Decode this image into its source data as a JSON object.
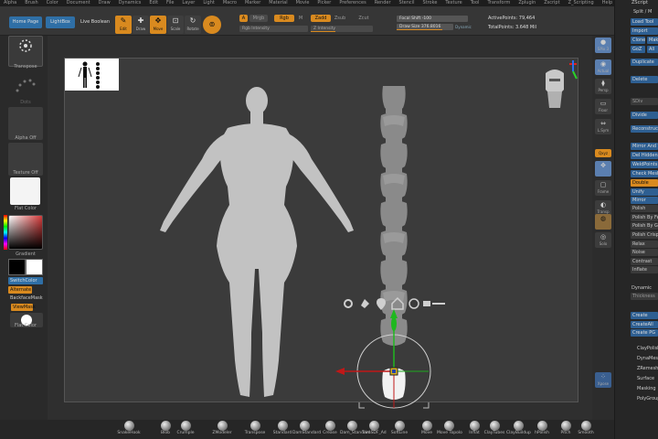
{
  "menu": [
    "Alpha",
    "Brush",
    "Color",
    "Document",
    "Draw",
    "Dynamics",
    "Edit",
    "File",
    "Layer",
    "Light",
    "Macro",
    "Marker",
    "Material",
    "Movie",
    "Picker",
    "Preferences",
    "Render",
    "Stencil",
    "Stroke",
    "Texture",
    "Tool",
    "Transform",
    "Zplugin",
    "Zscript",
    "Z_Scripting",
    "Help"
  ],
  "toolbar": {
    "home_page": "Home Page",
    "lightbox": "LightBox",
    "live_boolean": "Live Boolean",
    "edit": "Edit",
    "draw": "Draw",
    "move": "Move",
    "scale": "Scale",
    "rotate": "Rotate",
    "a_label": "A",
    "mrgb": "Mrgb",
    "rgb": "Rgb",
    "m": "M",
    "zadd": "Zadd",
    "zsub": "Zsub",
    "zcut": "Zcut",
    "rgb_intensity": "Rgb Intensity",
    "z_intensity": "Z Intensity",
    "focal_shift": "Focal Shift -100",
    "draw_size": "Draw Size 376.8016",
    "dynamic": "Dynamic",
    "active_points": "ActivePoints: 79,464",
    "total_points": "TotalPoints: 3.648 Mil"
  },
  "left": {
    "transpose": "Transpose",
    "dots": "Dots",
    "alpha_off": "Alpha Off",
    "texture_off": "Texture Off",
    "flat_color_material": "Flat Color",
    "gradient": "Gradient",
    "switch_color": "SwitchColor",
    "alternate": "Alternate",
    "backface_mask": "BackfaceMask",
    "view_mask": "ViewMask",
    "flat_color": "Flat Color"
  },
  "right": {
    "spix": "SPix 3",
    "actual": "Actual",
    "persp": "Persp",
    "floor": "Floor",
    "lsym": "L.Sym",
    "qxyz": "Qxyz",
    "transp": "Transp",
    "frame": "Frame",
    "solo": "Solo",
    "dynamic": "Dynamic",
    "xpose": "Xpose"
  },
  "palette": {
    "title": "ZScript",
    "split": "Split / M",
    "load_tool": "Load Tool",
    "import": "Import",
    "clone": "Clone",
    "make": "Make",
    "goz": "GoZ",
    "all": "All",
    "duplicate": "Duplicate",
    "delete": "Delete",
    "sdiv": "SDiv",
    "divide": "Divide",
    "reconstruct": "Reconstruct",
    "mirror_and_weld": "Mirror And Weld",
    "del_hidden": "Del Hidden",
    "weld_points": "WeldPoints",
    "check_mesh": "Check Mesh",
    "double": "Double",
    "unify": "Unify",
    "mirror": "Mirror",
    "polish": "Polish",
    "polish_by_features": "Polish By Features",
    "polish_by_groups": "Polish By Groups",
    "polish_crisp": "Polish Crisp",
    "relax": "Relax",
    "noise": "Noise",
    "contrast": "Contrast",
    "inflate": "Inflate",
    "dynamic": "Dynamic",
    "thickness": "Thickness",
    "create": "Create",
    "create_all": "CreateAll",
    "create_pg": "Create PG",
    "menu_items": [
      "ClayPolish",
      "DynaMesh",
      "ZRemesher",
      "Surface",
      "Masking",
      "PolyGroups"
    ]
  },
  "bottom": [
    "SnakeHook",
    "Blob",
    "Crumple",
    "ZModeler",
    "Transpose",
    "Standard",
    "DamStandard",
    "Crease",
    "Dam_Standard",
    "TrimSDF_Ad",
    "SoftLine",
    "Move",
    "Move Topolo",
    "Inflat",
    "ClayTubes",
    "ClayBuildup",
    "hPolish",
    "Pitch",
    "Smooth"
  ],
  "colors": {
    "accent": "#d98a1f",
    "blue": "#2e5f92",
    "bg": "#2e2e2e",
    "silhouette": "#c2c2c2"
  }
}
